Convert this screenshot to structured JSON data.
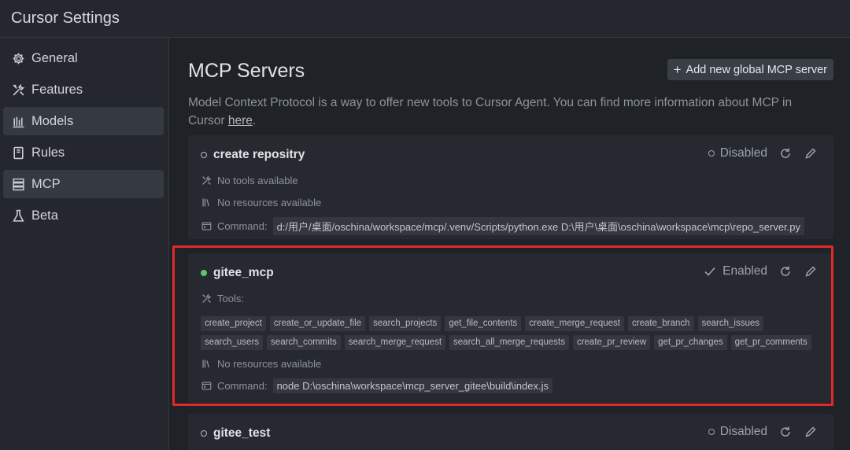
{
  "window": {
    "title": "Cursor Settings"
  },
  "sidebar": {
    "items": [
      {
        "label": "General",
        "icon": "gear-icon"
      },
      {
        "label": "Features",
        "icon": "tools-icon"
      },
      {
        "label": "Models",
        "icon": "chart-icon"
      },
      {
        "label": "Rules",
        "icon": "book-icon"
      },
      {
        "label": "MCP",
        "icon": "server-icon"
      },
      {
        "label": "Beta",
        "icon": "flask-icon"
      }
    ],
    "active": [
      "Models",
      "MCP"
    ]
  },
  "main": {
    "title": "MCP Servers",
    "add_button": "Add new global MCP server",
    "description": "Model Context Protocol is a way to offer new tools to Cursor Agent. You can find more information about MCP in Cursor ",
    "description_link": "here",
    "description_end": "."
  },
  "servers": [
    {
      "name": "create repositry",
      "status": "Disabled",
      "tools_label": "No tools available",
      "resources_label": "No resources available",
      "command_label": "Command:",
      "command": "d:/用户/桌面/oschina/workspace/mcp/.venv/Scripts/python.exe D:\\用户\\桌面\\oschina\\workspace\\mcp\\repo_server.py"
    },
    {
      "name": "gitee_mcp",
      "status": "Enabled",
      "tools_label": "Tools:",
      "tools": [
        "create_project",
        "create_or_update_file",
        "search_projects",
        "get_file_contents",
        "create_merge_request",
        "create_branch",
        "search_issues",
        "search_users",
        "search_commits",
        "search_merge_request",
        "search_all_merge_requests",
        "create_pr_review",
        "get_pr_changes",
        "get_pr_comments"
      ],
      "resources_label": "No resources available",
      "command_label": "Command:",
      "command": "node D:\\oschina\\workspace\\mcp_server_gitee\\build\\index.js"
    },
    {
      "name": "gitee_test",
      "status": "Disabled"
    }
  ],
  "colors": {
    "enabled_dot": "#5cc46d",
    "highlight_border": "#e02a2a"
  }
}
